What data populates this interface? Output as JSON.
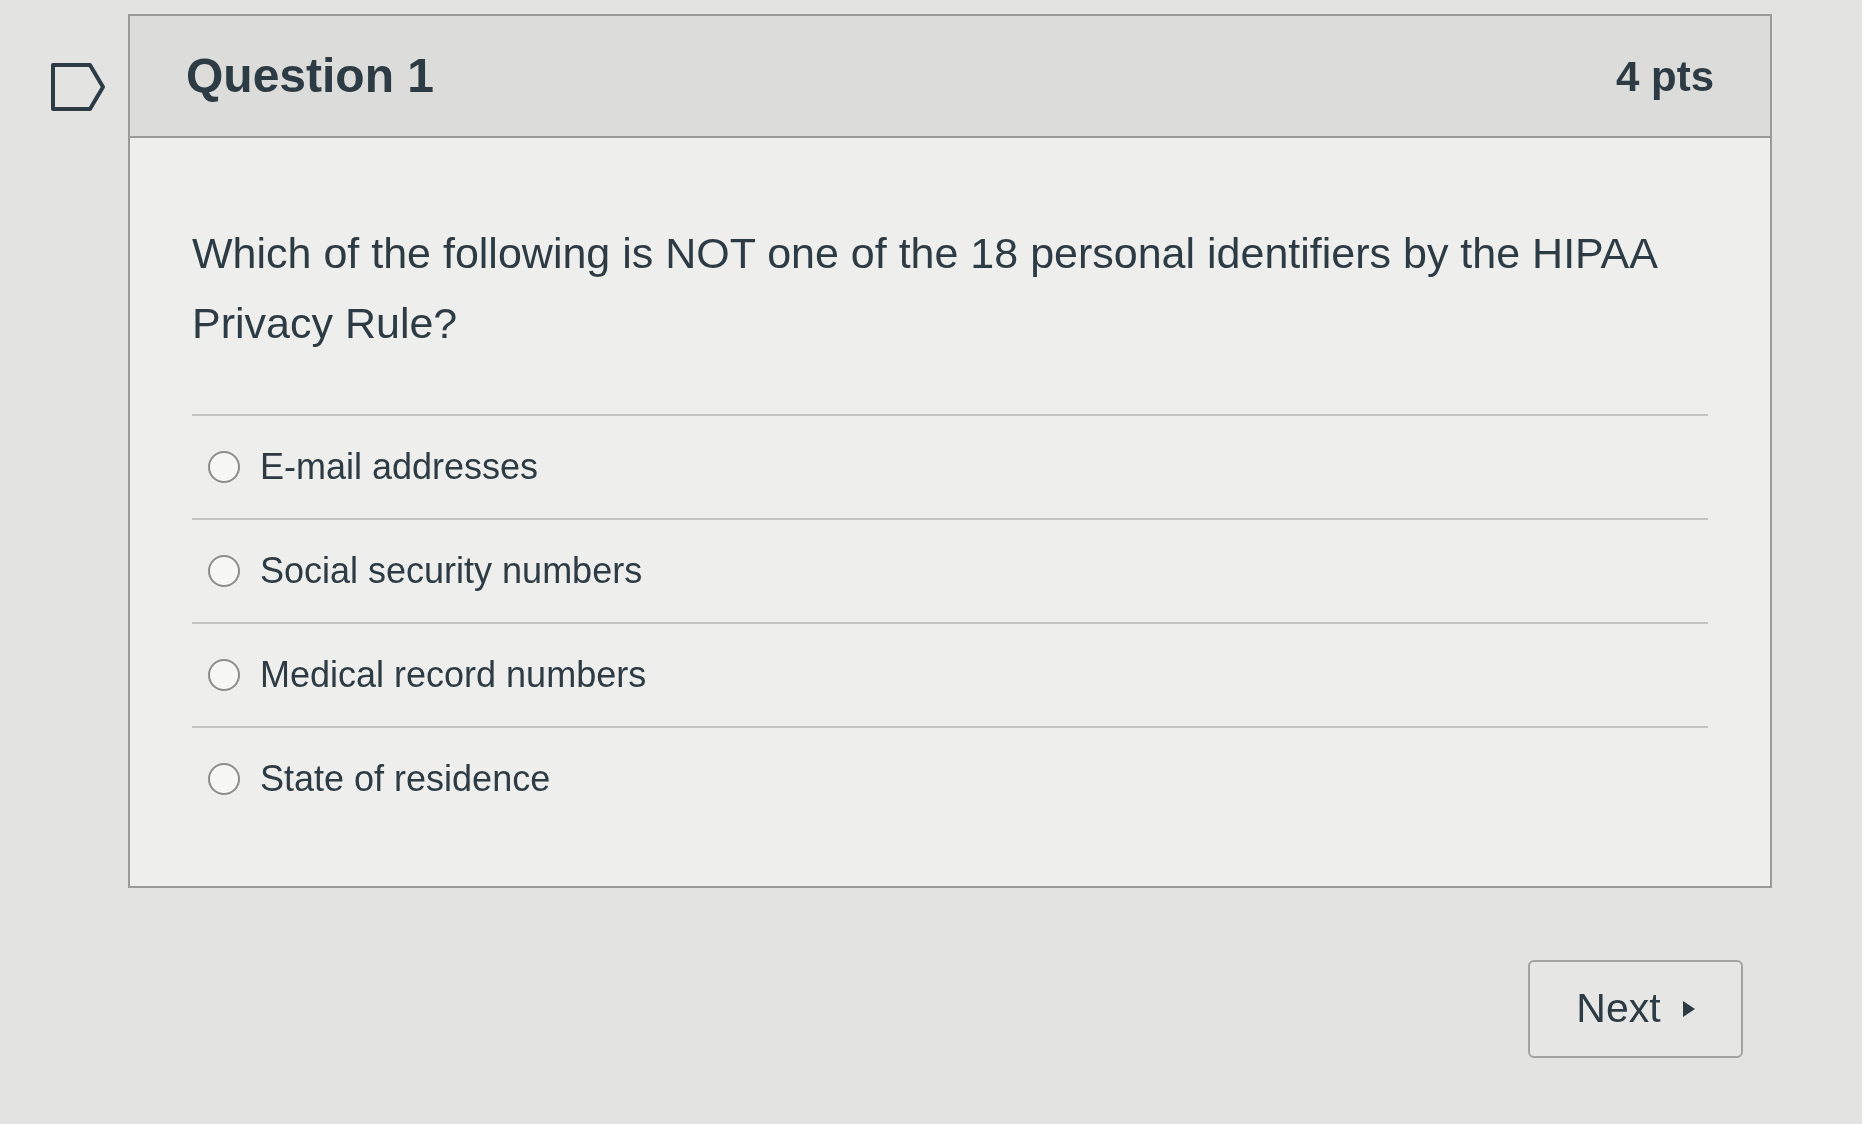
{
  "question": {
    "title": "Question 1",
    "points": "4 pts"
  },
  "prompt": "Which of the following is NOT one of the 18 personal identifiers by the HIPAA Privacy Rule?",
  "options": [
    {
      "label": "E-mail addresses",
      "selected": false
    },
    {
      "label": "Social security numbers",
      "selected": false
    },
    {
      "label": "Medical record numbers",
      "selected": false
    },
    {
      "label": "State of residence",
      "selected": false
    }
  ],
  "next_button": {
    "label": "Next"
  }
}
